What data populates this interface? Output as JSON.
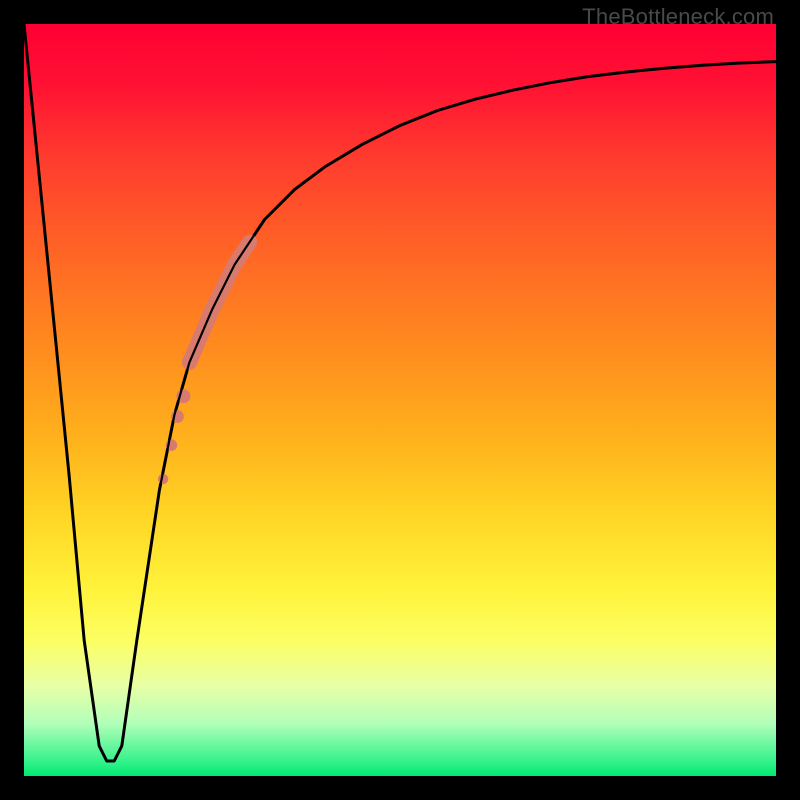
{
  "attribution": "TheBottleneck.com",
  "colors": {
    "background": "#000000",
    "curve": "#000000",
    "highlight": "#d87a6e",
    "gradient_top": "#ff0033",
    "gradient_bottom": "#00e86f"
  },
  "chart_data": {
    "type": "line",
    "title": "",
    "xlabel": "",
    "ylabel": "",
    "xlim": [
      0,
      100
    ],
    "ylim": [
      0,
      100
    ],
    "grid": false,
    "legend": false,
    "series": [
      {
        "name": "bottleneck-curve",
        "x": [
          0,
          3,
          6,
          8,
          10,
          11,
          12,
          13,
          15,
          18,
          20,
          22,
          25,
          28,
          32,
          36,
          40,
          45,
          50,
          55,
          60,
          65,
          70,
          75,
          80,
          85,
          90,
          95,
          100
        ],
        "y": [
          100,
          70,
          40,
          18,
          4,
          2,
          2,
          4,
          18,
          38,
          48,
          55,
          62,
          68,
          74,
          78,
          81,
          84,
          86.5,
          88.5,
          90,
          91.2,
          92.2,
          93,
          93.6,
          94.1,
          94.5,
          94.8,
          95
        ]
      }
    ],
    "annotations": {
      "highlight_band": {
        "name": "rising-segment-highlight",
        "color": "#d87a6e",
        "description": "Thick salmon stroke over ascending curve segment",
        "x_range": [
          22,
          30
        ],
        "y_range": [
          40,
          70
        ]
      },
      "highlight_dots": {
        "name": "rising-segment-dots",
        "color": "#d87a6e",
        "points": [
          {
            "x": 21.2,
            "y": 50.5
          },
          {
            "x": 20.4,
            "y": 47.8
          },
          {
            "x": 19.6,
            "y": 44.0
          },
          {
            "x": 18.5,
            "y": 39.5
          }
        ]
      }
    }
  }
}
